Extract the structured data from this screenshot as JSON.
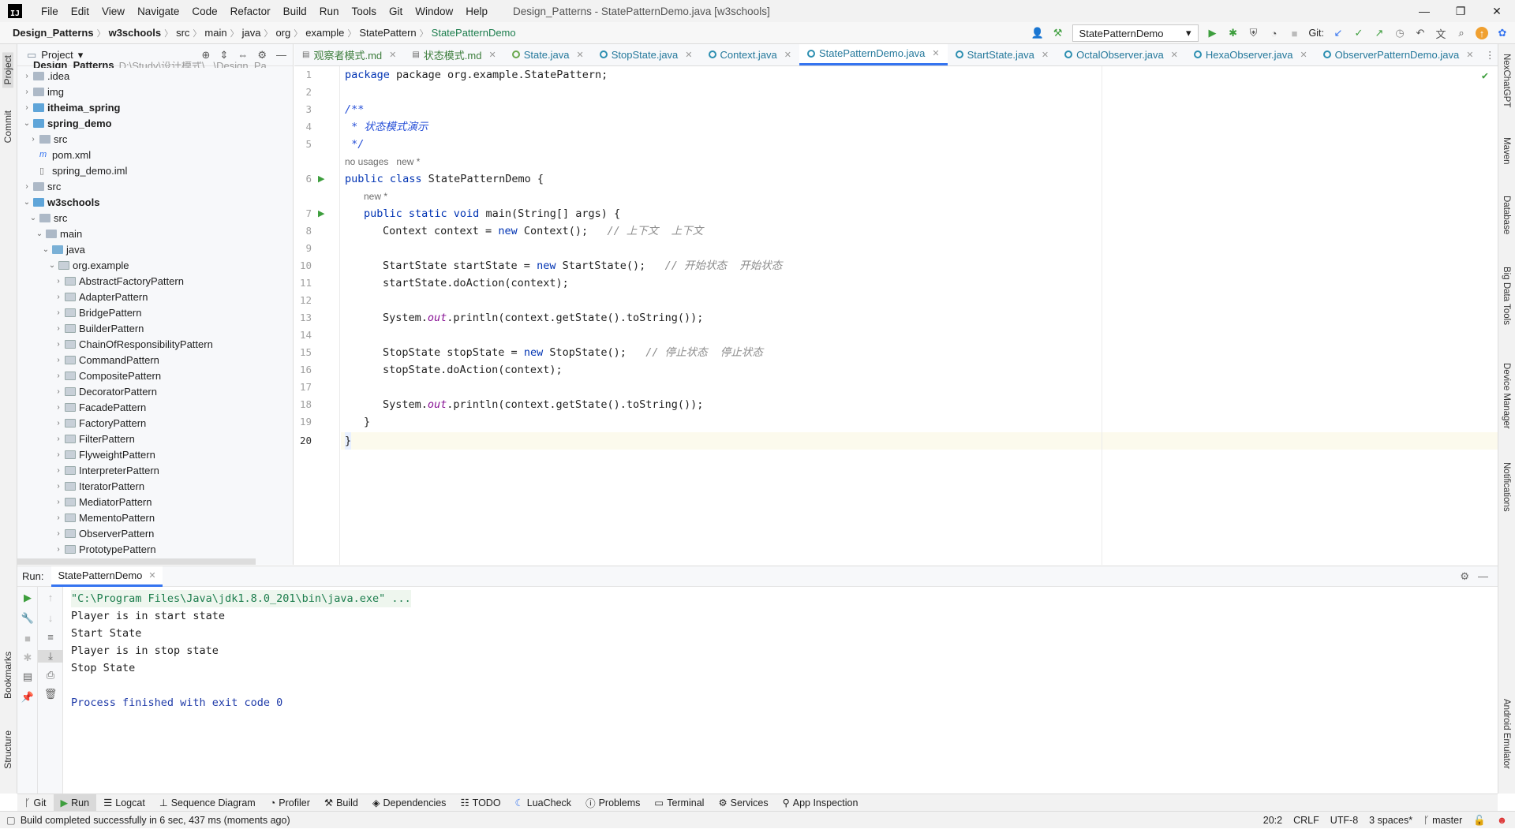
{
  "window": {
    "title": "Design_Patterns - StatePatternDemo.java [w3schools]",
    "menus": [
      "File",
      "Edit",
      "View",
      "Navigate",
      "Code",
      "Refactor",
      "Build",
      "Run",
      "Tools",
      "Git",
      "Window",
      "Help"
    ],
    "minimize": "—",
    "maximize": "❐",
    "close": "✕"
  },
  "breadcrumb": [
    "Design_Patterns",
    "w3schools",
    "src",
    "main",
    "java",
    "org",
    "example",
    "StatePattern",
    "StatePatternDemo"
  ],
  "toolbar_top": {
    "run_config": "StatePatternDemo",
    "git_label": "Git:"
  },
  "left_strip": {
    "project": "Project",
    "commit": "Commit",
    "bookmarks": "Bookmarks",
    "structure": "Structure"
  },
  "right_strip": [
    "NexChatGPT",
    "Maven",
    "Database",
    "Big Data Tools",
    "Device Manager",
    "Notifications",
    "Android Emulator"
  ],
  "project_panel": {
    "title": "Project",
    "top_item": "Design_Patterns",
    "top_item_path": "D:\\Study\\设计模式\\...\\Design_Pa",
    "items": [
      {
        "label": ".idea",
        "indent": 0,
        "arrow": "›",
        "type": "folder"
      },
      {
        "label": "img",
        "indent": 0,
        "arrow": "›",
        "type": "folder"
      },
      {
        "label": "itheima_spring",
        "indent": 0,
        "arrow": "›",
        "type": "module",
        "bold": true
      },
      {
        "label": "spring_demo",
        "indent": 0,
        "arrow": "⌄",
        "type": "module",
        "bold": true
      },
      {
        "label": "src",
        "indent": 1,
        "arrow": "›",
        "type": "folder"
      },
      {
        "label": "pom.xml",
        "indent": 1,
        "arrow": "",
        "type": "maven"
      },
      {
        "label": "spring_demo.iml",
        "indent": 1,
        "arrow": "",
        "type": "iml"
      },
      {
        "label": "src",
        "indent": 0,
        "arrow": "›",
        "type": "folder"
      },
      {
        "label": "w3schools",
        "indent": 0,
        "arrow": "⌄",
        "type": "module",
        "bold": true
      },
      {
        "label": "src",
        "indent": 1,
        "arrow": "⌄",
        "type": "folder"
      },
      {
        "label": "main",
        "indent": 2,
        "arrow": "⌄",
        "type": "folder"
      },
      {
        "label": "java",
        "indent": 3,
        "arrow": "⌄",
        "type": "src"
      },
      {
        "label": "org.example",
        "indent": 4,
        "arrow": "⌄",
        "type": "pkg"
      },
      {
        "label": "AbstractFactoryPattern",
        "indent": 5,
        "arrow": "›",
        "type": "pkg"
      },
      {
        "label": "AdapterPattern",
        "indent": 5,
        "arrow": "›",
        "type": "pkg"
      },
      {
        "label": "BridgePattern",
        "indent": 5,
        "arrow": "›",
        "type": "pkg"
      },
      {
        "label": "BuilderPattern",
        "indent": 5,
        "arrow": "›",
        "type": "pkg"
      },
      {
        "label": "ChainOfResponsibilityPattern",
        "indent": 5,
        "arrow": "›",
        "type": "pkg"
      },
      {
        "label": "CommandPattern",
        "indent": 5,
        "arrow": "›",
        "type": "pkg"
      },
      {
        "label": "CompositePattern",
        "indent": 5,
        "arrow": "›",
        "type": "pkg"
      },
      {
        "label": "DecoratorPattern",
        "indent": 5,
        "arrow": "›",
        "type": "pkg"
      },
      {
        "label": "FacadePattern",
        "indent": 5,
        "arrow": "›",
        "type": "pkg"
      },
      {
        "label": "FactoryPattern",
        "indent": 5,
        "arrow": "›",
        "type": "pkg"
      },
      {
        "label": "FilterPattern",
        "indent": 5,
        "arrow": "›",
        "type": "pkg"
      },
      {
        "label": "FlyweightPattern",
        "indent": 5,
        "arrow": "›",
        "type": "pkg"
      },
      {
        "label": "InterpreterPattern",
        "indent": 5,
        "arrow": "›",
        "type": "pkg"
      },
      {
        "label": "IteratorPattern",
        "indent": 5,
        "arrow": "›",
        "type": "pkg"
      },
      {
        "label": "MediatorPattern",
        "indent": 5,
        "arrow": "›",
        "type": "pkg"
      },
      {
        "label": "MementoPattern",
        "indent": 5,
        "arrow": "›",
        "type": "pkg"
      },
      {
        "label": "ObserverPattern",
        "indent": 5,
        "arrow": "›",
        "type": "pkg"
      },
      {
        "label": "PrototypePattern",
        "indent": 5,
        "arrow": "›",
        "type": "pkg"
      }
    ]
  },
  "editor_tabs": [
    {
      "label": "观察者模式.md",
      "kind": "md",
      "active": false
    },
    {
      "label": "状态模式.md",
      "kind": "md",
      "active": false
    },
    {
      "label": "State.java",
      "kind": "interface",
      "active": false
    },
    {
      "label": "StopState.java",
      "kind": "class",
      "active": false
    },
    {
      "label": "Context.java",
      "kind": "class",
      "active": false
    },
    {
      "label": "StatePatternDemo.java",
      "kind": "class",
      "active": true
    },
    {
      "label": "StartState.java",
      "kind": "class",
      "active": false
    },
    {
      "label": "OctalObserver.java",
      "kind": "class",
      "active": false
    },
    {
      "label": "HexaObserver.java",
      "kind": "class",
      "active": false
    },
    {
      "label": "ObserverPatternDemo.java",
      "kind": "class",
      "active": false
    }
  ],
  "code": {
    "line1": "package org.example.StatePattern;",
    "line3": "/**",
    "line4": " * 状态模式演示",
    "line5": " */",
    "hint1a": "no usages",
    "hint1b": "new *",
    "line6a": "public class ",
    "line6b": "StatePatternDemo {",
    "hint2": "new *",
    "line7a": "public static void ",
    "line7b": "main(String[] args) {",
    "line8a": "Context context = ",
    "line8b": "new ",
    "line8c": "Context();",
    "line8cm": "// 上下文  上下文",
    "line10a": "StartState startState = ",
    "line10b": "new ",
    "line10c": "StartState();",
    "line10cm": "// 开始状态  开始状态",
    "line11": "startState.doAction(context);",
    "line13a": "System.",
    "line13b": "out",
    "line13c": ".println(context.getState().toString());",
    "line15a": "StopState stopState = ",
    "line15b": "new ",
    "line15c": "StopState();",
    "line15cm": "// 停止状态  停止状态",
    "line16": "stopState.doAction(context);",
    "line18a": "System.",
    "line18b": "out",
    "line18c": ".println(context.getState().toString());",
    "line19": "}",
    "line20": "}",
    "line_numbers": [
      "1",
      "2",
      "3",
      "4",
      "5",
      "6",
      "7",
      "8",
      "9",
      "10",
      "11",
      "12",
      "13",
      "14",
      "15",
      "16",
      "17",
      "18",
      "19",
      "20"
    ]
  },
  "run_panel": {
    "label": "Run:",
    "tab": "StatePatternDemo",
    "output": [
      "\"C:\\Program Files\\Java\\jdk1.8.0_201\\bin\\java.exe\" ...",
      "Player is in start state",
      "Start State",
      "Player is in stop state",
      "Stop State",
      "",
      "Process finished with exit code 0"
    ]
  },
  "bottom_tools": [
    "Git",
    "Run",
    "Logcat",
    "Sequence Diagram",
    "Profiler",
    "Build",
    "Dependencies",
    "TODO",
    "LuaCheck",
    "Problems",
    "Terminal",
    "Services",
    "App Inspection"
  ],
  "status": {
    "message": "Build completed successfully in 6 sec, 437 ms (moments ago)",
    "position": "20:2",
    "line_sep": "CRLF",
    "encoding": "UTF-8",
    "indent": "3 spaces*",
    "branch": "master"
  }
}
